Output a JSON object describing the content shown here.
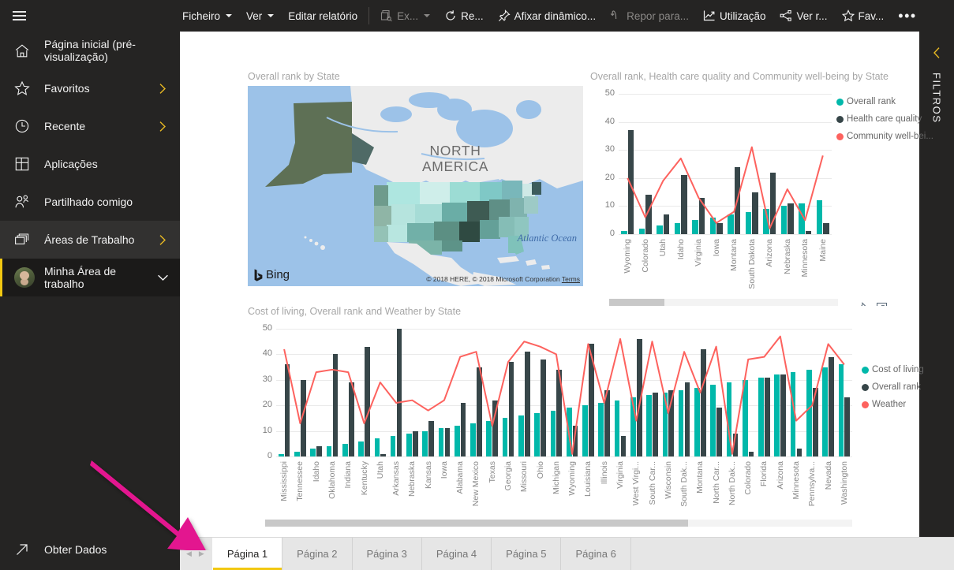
{
  "topbar": {
    "menu_icon": "hamburger-icon",
    "items": [
      {
        "id": "ficheiro",
        "label": "Ficheiro",
        "caret": true,
        "icon": null,
        "disabled": false
      },
      {
        "id": "ver",
        "label": "Ver",
        "caret": true,
        "icon": null,
        "disabled": false
      },
      {
        "id": "editar-relatorio",
        "label": "Editar relatório",
        "caret": false,
        "icon": null,
        "disabled": false
      },
      {
        "id": "exportar",
        "label": "Ex...",
        "caret": true,
        "icon": "export-icon",
        "disabled": true
      },
      {
        "id": "renovar",
        "label": "Re...",
        "caret": false,
        "icon": "refresh-icon",
        "disabled": false
      },
      {
        "id": "afixar-dinamico",
        "label": "Afixar dinâmico...",
        "caret": false,
        "icon": "pin-icon",
        "disabled": false
      },
      {
        "id": "repor-para",
        "label": "Repor para...",
        "caret": false,
        "icon": "reset-icon",
        "disabled": true
      },
      {
        "id": "utilizacao",
        "label": "Utilização",
        "caret": false,
        "icon": "usage-chart-icon",
        "disabled": false
      },
      {
        "id": "ver-relacionados",
        "label": "Ver r...",
        "caret": false,
        "icon": "related-icon",
        "disabled": false
      },
      {
        "id": "favorito",
        "label": "Fav...",
        "caret": false,
        "icon": "star-icon",
        "disabled": false
      }
    ],
    "overflow_label": "•••"
  },
  "sidebar": {
    "items": [
      {
        "id": "pagina-inicial",
        "label": "Página inicial (pré-visualização)",
        "icon": "home-icon",
        "chevron": null,
        "state": "normal"
      },
      {
        "id": "favoritos",
        "label": "Favoritos",
        "icon": "star-icon",
        "chevron": "chevron-right-icon",
        "state": "normal"
      },
      {
        "id": "recente",
        "label": "Recente",
        "icon": "clock-icon",
        "chevron": "chevron-right-icon",
        "state": "normal"
      },
      {
        "id": "aplicacoes",
        "label": "Aplicações",
        "icon": "apps-grid-icon",
        "chevron": null,
        "state": "normal"
      },
      {
        "id": "partilhado-comigo",
        "label": "Partilhado comigo",
        "icon": "shared-people-icon",
        "chevron": null,
        "state": "normal"
      },
      {
        "id": "areas-de-trabalho",
        "label": "Áreas de Trabalho",
        "icon": "workspaces-icon",
        "chevron": "chevron-right-icon",
        "state": "selected"
      },
      {
        "id": "minha-area-de-trabalho",
        "label": "Minha Área de trabalho",
        "icon": "avatar",
        "chevron": "chevron-down-icon",
        "state": "active"
      }
    ],
    "bottom": {
      "id": "obter-dados",
      "label": "Obter Dados",
      "icon": "arrow-up-right-icon"
    }
  },
  "filters_rail": {
    "label": "FILTROS",
    "collapse_icon": "chevron-left-icon"
  },
  "visual_actions": {
    "pin_icon": "pin-icon",
    "focus_icon": "focus-mode-icon",
    "more_icon": "more-options-icon",
    "more_label": "•••"
  },
  "map_visual": {
    "title": "Overall rank by State",
    "north_america_label": "NORTH AMERICA",
    "ocean_label": "Atlantic Ocean",
    "bing_label": "Bing",
    "credit": "© 2018 HERE, © 2018 Microsoft Corporation",
    "terms_label": "Terms"
  },
  "pagebar": {
    "prev_label": "◀",
    "next_label": "▶",
    "tabs": [
      {
        "label": "Página 1",
        "active": true
      },
      {
        "label": "Página 2",
        "active": false
      },
      {
        "label": "Página 3",
        "active": false
      },
      {
        "label": "Página 4",
        "active": false
      },
      {
        "label": "Página 5",
        "active": false
      },
      {
        "label": "Página 6",
        "active": false
      }
    ]
  },
  "colors": {
    "teal": "#01b8aa",
    "dark": "#374649",
    "red": "#fd625e",
    "accent_yellow": "#f2c811",
    "chrome_dark": "#252423",
    "annotation_pink": "#e3158f"
  },
  "chart_data": [
    {
      "id": "chart-top-right",
      "type": "bar",
      "title": "Overall rank, Health care quality and Community well-being by State",
      "xlabel": "",
      "ylabel": "",
      "ylim": [
        0,
        50
      ],
      "yticks": [
        0,
        10,
        20,
        30,
        40,
        50
      ],
      "grid": true,
      "legend_position": "right",
      "has_horizontal_scrollbar": true,
      "scrollbar_thumb_fraction": 0.24,
      "categories": [
        "Wyoming",
        "Colorado",
        "Utah",
        "Idaho",
        "Virginia",
        "Iowa",
        "Montana",
        "South Dakota",
        "Arizona",
        "Nebraska",
        "Minnesota",
        "Maine"
      ],
      "series": [
        {
          "name": "Overall rank",
          "type": "column",
          "color": "#01b8aa",
          "values": [
            1,
            2,
            3,
            4,
            5,
            6,
            7,
            8,
            9,
            10,
            11,
            12
          ]
        },
        {
          "name": "Health care quality",
          "type": "column",
          "color": "#374649",
          "values": [
            37,
            14,
            7,
            21,
            13,
            4,
            24,
            15,
            22,
            11,
            1,
            4
          ]
        },
        {
          "name": "Community well-bei...",
          "type": "line",
          "color": "#fd625e",
          "values": [
            20,
            6,
            19,
            27,
            13,
            4,
            8,
            31,
            2,
            16,
            5,
            28
          ]
        }
      ]
    },
    {
      "id": "chart-bottom",
      "type": "bar",
      "title": "Cost of living, Overall rank and Weather by State",
      "xlabel": "",
      "ylabel": "",
      "ylim": [
        0,
        50
      ],
      "yticks": [
        0,
        10,
        20,
        30,
        40,
        50
      ],
      "grid": true,
      "legend_position": "right",
      "has_horizontal_scrollbar": true,
      "scrollbar_thumb_fraction": 0.72,
      "categories": [
        "Mississippi",
        "Tennessee",
        "Idaho",
        "Oklahoma",
        "Indiana",
        "Kentucky",
        "Utah",
        "Arkansas",
        "Nebraska",
        "Kansas",
        "Iowa",
        "Alabama",
        "New Mexico",
        "Texas",
        "Georgia",
        "Missouri",
        "Ohio",
        "Michigan",
        "Wyoming",
        "Louisiana",
        "Illinois",
        "Virginia",
        "West Virgi...",
        "South Car...",
        "Wisconsin",
        "South Dak...",
        "Montana",
        "North Car...",
        "North Dak...",
        "Colorado",
        "Florida",
        "Arizona",
        "Minnesota",
        "Pennsylva...",
        "Nevada",
        "Washington"
      ],
      "series": [
        {
          "name": "Cost of living",
          "type": "column",
          "color": "#01b8aa",
          "values": [
            1,
            2,
            3,
            4,
            5,
            6,
            7,
            8,
            9,
            10,
            11,
            12,
            13,
            14,
            15,
            16,
            17,
            18,
            19,
            20,
            21,
            22,
            23,
            24,
            25,
            26,
            27,
            28,
            29,
            30,
            31,
            32,
            33,
            34,
            35,
            36
          ]
        },
        {
          "name": "Overall rank",
          "type": "column",
          "color": "#374649",
          "values": [
            36,
            30,
            4,
            40,
            29,
            43,
            1,
            50,
            10,
            14,
            11,
            21,
            35,
            22,
            37,
            41,
            38,
            34,
            12,
            44,
            26,
            8,
            46,
            25,
            26,
            29,
            42,
            19,
            9,
            2,
            31,
            32,
            3,
            27,
            39,
            23
          ]
        },
        {
          "name": "Weather",
          "type": "line",
          "color": "#fd625e",
          "values": [
            42,
            13,
            33,
            34,
            33,
            13,
            29,
            21,
            22,
            18,
            22,
            39,
            41,
            12,
            37,
            45,
            43,
            40,
            1,
            44,
            21,
            46,
            14,
            45,
            17,
            41,
            25,
            43,
            1,
            38,
            39,
            47,
            14,
            20,
            44,
            36
          ]
        }
      ]
    }
  ]
}
